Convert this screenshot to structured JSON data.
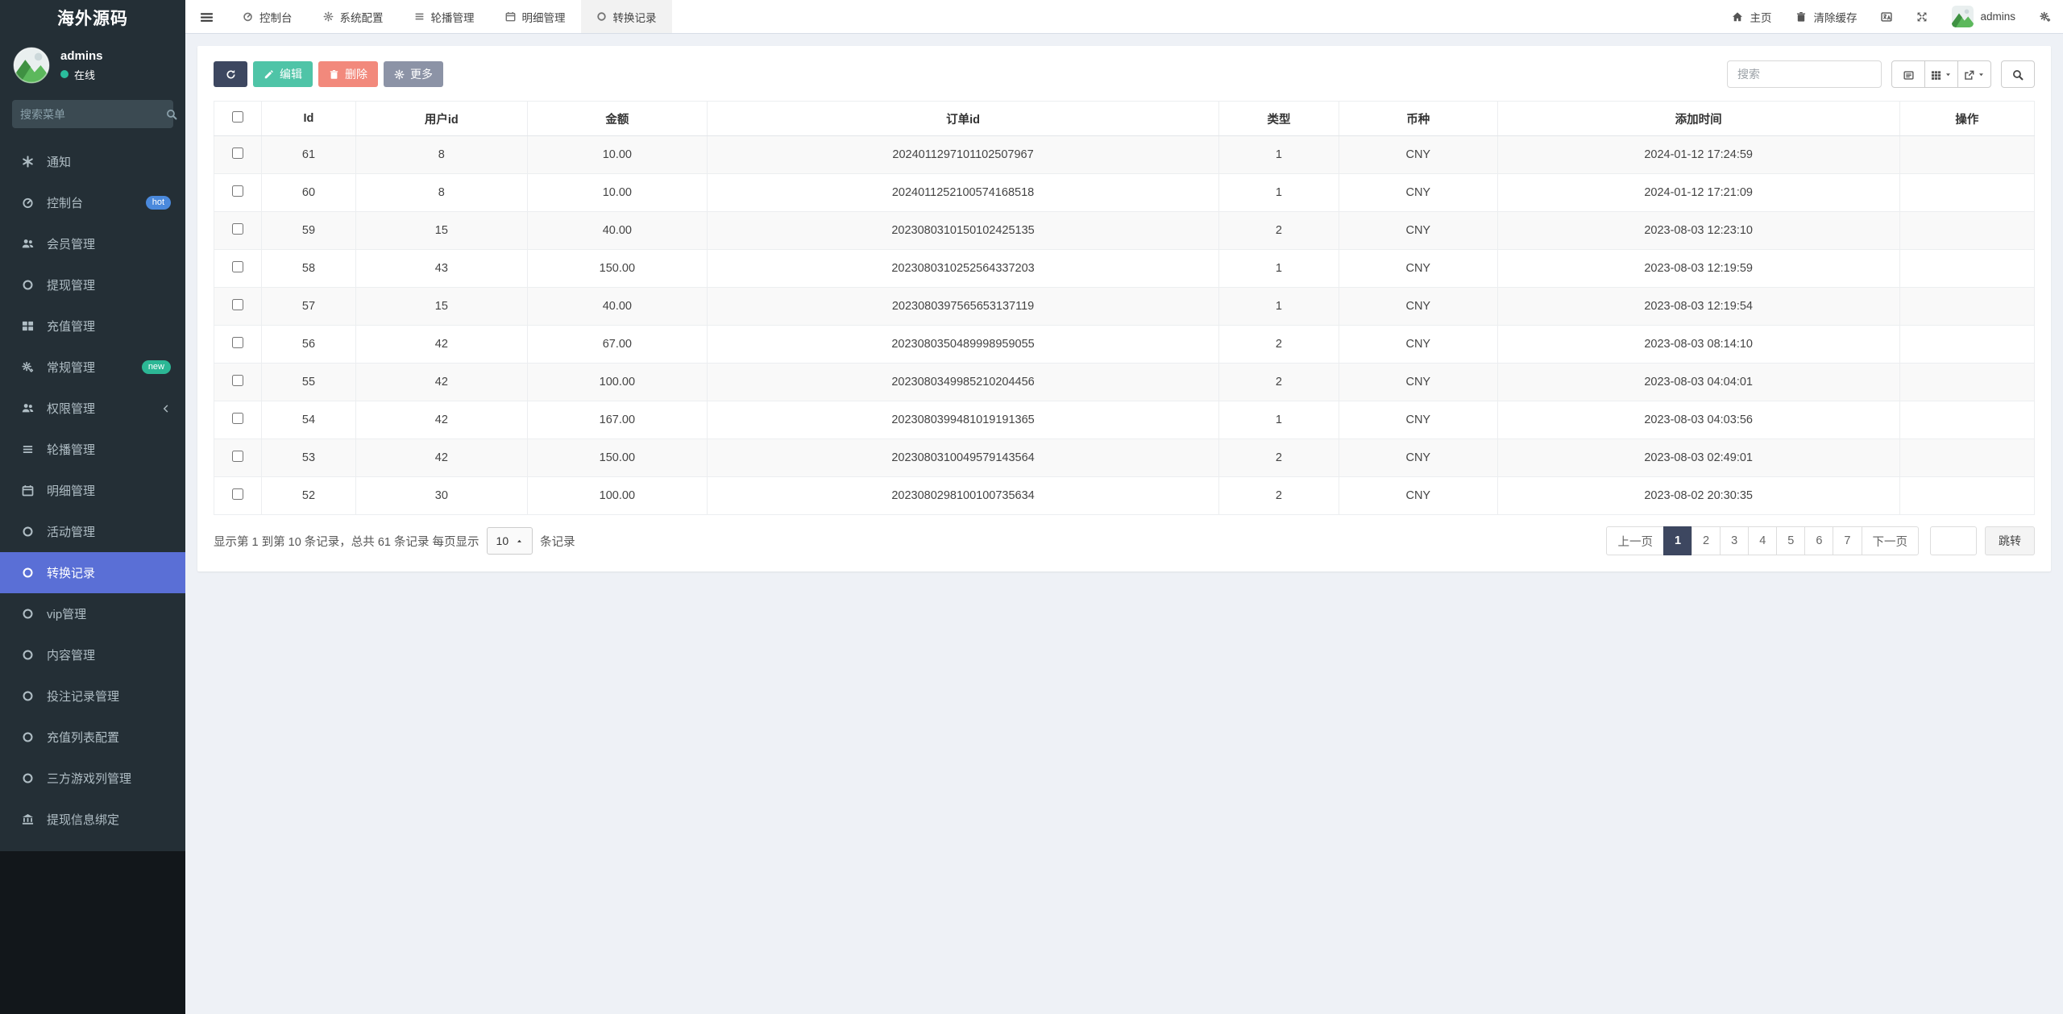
{
  "brand": "海外源码",
  "user": {
    "name": "admins",
    "status": "在线"
  },
  "colors": {
    "accent": "#5a6fd6",
    "navy": "#3d4760",
    "green": "#4fc4a7",
    "red": "#f2897c",
    "gray": "#8c93a6",
    "online": "#2abd9c",
    "badge_hot": "#4a89dc",
    "badge_new": "#2cb795"
  },
  "sidebar": {
    "search_placeholder": "搜索菜单",
    "items": [
      {
        "key": "notice",
        "label": "通知",
        "icon": "asterisk-icon"
      },
      {
        "key": "console",
        "label": "控制台",
        "icon": "dashboard-icon",
        "badge": "hot",
        "badge_color": "#4a89dc"
      },
      {
        "key": "members",
        "label": "会员管理",
        "icon": "users-icon"
      },
      {
        "key": "withdraw",
        "label": "提现管理",
        "icon": "circle-icon"
      },
      {
        "key": "recharge",
        "label": "充值管理",
        "icon": "th-large-icon"
      },
      {
        "key": "general",
        "label": "常规管理",
        "icon": "cogs-icon",
        "badge": "new",
        "badge_color": "#2cb795"
      },
      {
        "key": "permission",
        "label": "权限管理",
        "icon": "users-icon",
        "chevron": true
      },
      {
        "key": "carousel",
        "label": "轮播管理",
        "icon": "list-icon"
      },
      {
        "key": "detail",
        "label": "明细管理",
        "icon": "calendar-icon"
      },
      {
        "key": "activity",
        "label": "活动管理",
        "icon": "circle-icon"
      },
      {
        "key": "convert-records",
        "label": "转换记录",
        "icon": "circle-icon",
        "active": true
      },
      {
        "key": "vip",
        "label": "vip管理",
        "icon": "circle-icon"
      },
      {
        "key": "content",
        "label": "内容管理",
        "icon": "circle-icon"
      },
      {
        "key": "bet-records",
        "label": "投注记录管理",
        "icon": "circle-icon"
      },
      {
        "key": "recharge-list",
        "label": "充值列表配置",
        "icon": "circle-icon"
      },
      {
        "key": "third-games",
        "label": "三方游戏列管理",
        "icon": "circle-icon"
      },
      {
        "key": "withdraw-binding",
        "label": "提现信息绑定",
        "icon": "bank-icon"
      }
    ]
  },
  "topnav": {
    "tabs": [
      {
        "key": "console",
        "label": "控制台",
        "icon": "dashboard-icon"
      },
      {
        "key": "system-config",
        "label": "系统配置",
        "icon": "gear-icon"
      },
      {
        "key": "carousel",
        "label": "轮播管理",
        "icon": "list-icon"
      },
      {
        "key": "detail",
        "label": "明细管理",
        "icon": "calendar-icon"
      },
      {
        "key": "convert-records",
        "label": "转换记录",
        "icon": "circle-icon",
        "active": true
      }
    ],
    "home_label": "主页",
    "clear_cache_label": "清除缓存",
    "username": "admins"
  },
  "toolbar": {
    "edit_label": "编辑",
    "delete_label": "删除",
    "more_label": "更多",
    "search_placeholder": "搜索"
  },
  "table": {
    "columns": [
      "Id",
      "用户id",
      "金额",
      "订单id",
      "类型",
      "币种",
      "添加时间",
      "操作"
    ],
    "rows": [
      {
        "id": "61",
        "user_id": "8",
        "amount": "10.00",
        "order_id": "2024011297101102507967",
        "type": "1",
        "currency": "CNY",
        "created_at": "2024-01-12 17:24:59",
        "action": ""
      },
      {
        "id": "60",
        "user_id": "8",
        "amount": "10.00",
        "order_id": "2024011252100574168518",
        "type": "1",
        "currency": "CNY",
        "created_at": "2024-01-12 17:21:09",
        "action": ""
      },
      {
        "id": "59",
        "user_id": "15",
        "amount": "40.00",
        "order_id": "2023080310150102425135",
        "type": "2",
        "currency": "CNY",
        "created_at": "2023-08-03 12:23:10",
        "action": ""
      },
      {
        "id": "58",
        "user_id": "43",
        "amount": "150.00",
        "order_id": "2023080310252564337203",
        "type": "1",
        "currency": "CNY",
        "created_at": "2023-08-03 12:19:59",
        "action": ""
      },
      {
        "id": "57",
        "user_id": "15",
        "amount": "40.00",
        "order_id": "2023080397565653137119",
        "type": "1",
        "currency": "CNY",
        "created_at": "2023-08-03 12:19:54",
        "action": ""
      },
      {
        "id": "56",
        "user_id": "42",
        "amount": "67.00",
        "order_id": "2023080350489998959055",
        "type": "2",
        "currency": "CNY",
        "created_at": "2023-08-03 08:14:10",
        "action": ""
      },
      {
        "id": "55",
        "user_id": "42",
        "amount": "100.00",
        "order_id": "2023080349985210204456",
        "type": "2",
        "currency": "CNY",
        "created_at": "2023-08-03 04:04:01",
        "action": ""
      },
      {
        "id": "54",
        "user_id": "42",
        "amount": "167.00",
        "order_id": "2023080399481019191365",
        "type": "1",
        "currency": "CNY",
        "created_at": "2023-08-03 04:03:56",
        "action": ""
      },
      {
        "id": "53",
        "user_id": "42",
        "amount": "150.00",
        "order_id": "2023080310049579143564",
        "type": "2",
        "currency": "CNY",
        "created_at": "2023-08-03 02:49:01",
        "action": ""
      },
      {
        "id": "52",
        "user_id": "30",
        "amount": "100.00",
        "order_id": "2023080298100100735634",
        "type": "2",
        "currency": "CNY",
        "created_at": "2023-08-02 20:30:35",
        "action": ""
      }
    ]
  },
  "pagination": {
    "summary_prefix": "显示第 1 到第 10 条记录，总共 61 条记录 每页显示",
    "page_size": "10",
    "summary_suffix": "条记录",
    "prev_label": "上一页",
    "pages": [
      "1",
      "2",
      "3",
      "4",
      "5",
      "6",
      "7"
    ],
    "active_page": "1",
    "next_label": "下一页",
    "jump_label": "跳转"
  }
}
